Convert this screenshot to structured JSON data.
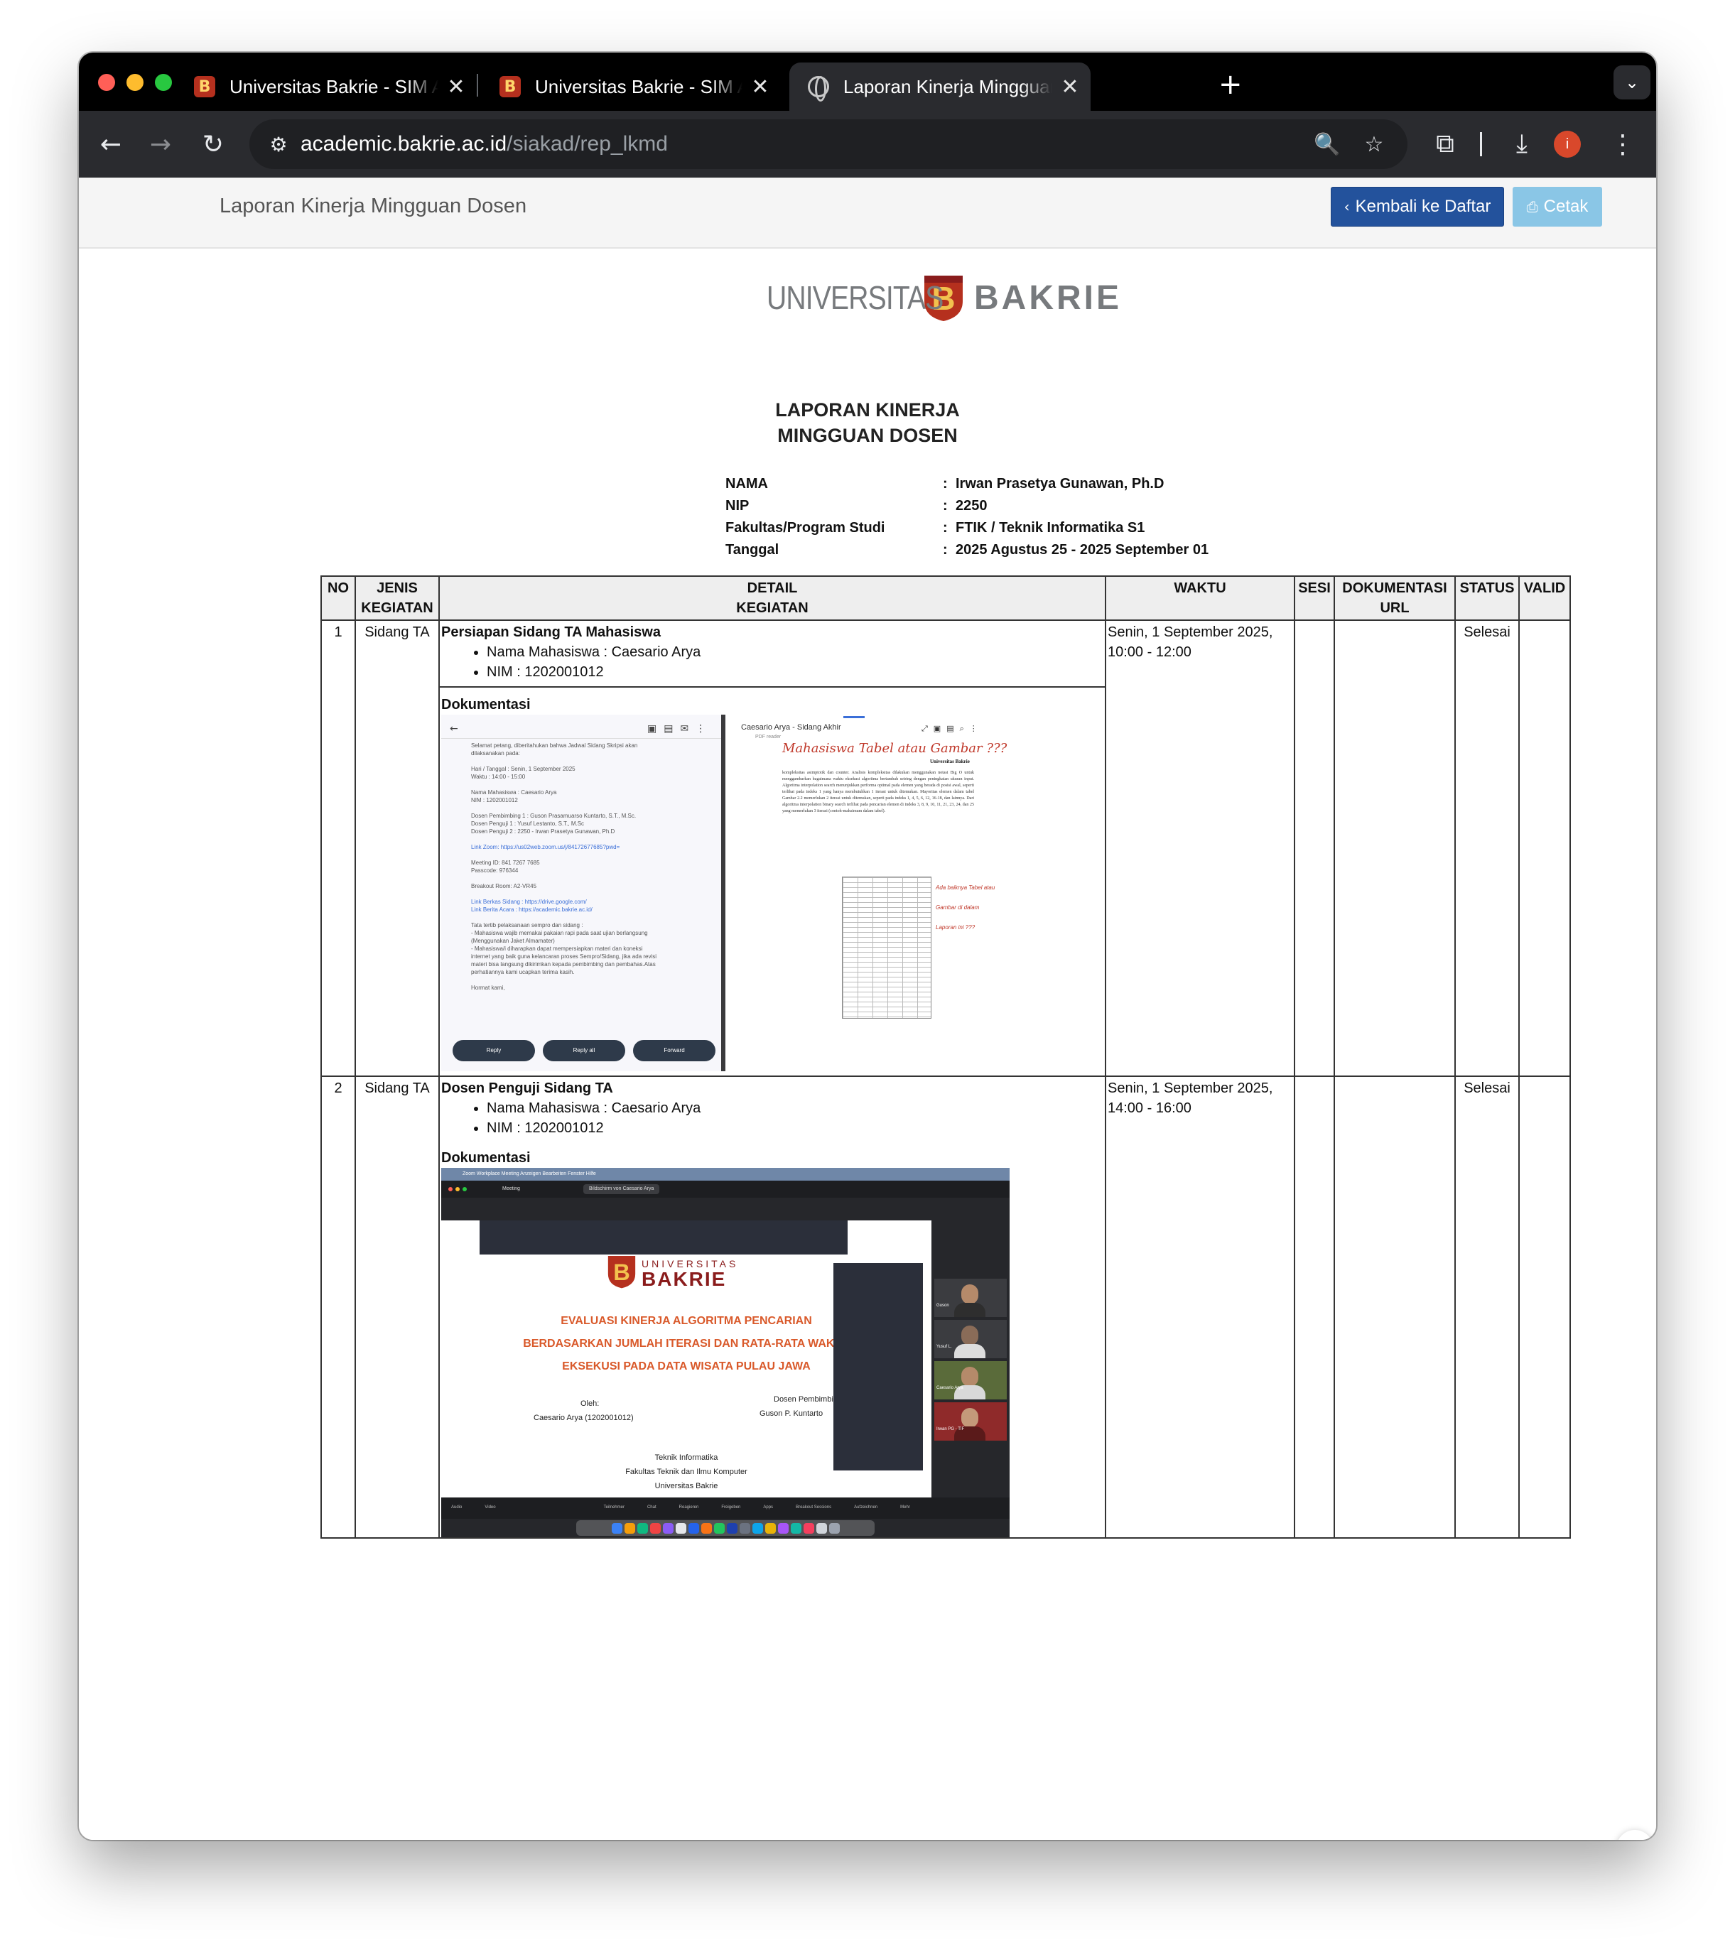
{
  "browser": {
    "tabs": [
      {
        "title": "Universitas Bakrie - SIM Akademik",
        "favicon": "ub-logo-icon",
        "active": false
      },
      {
        "title": "Universitas Bakrie - SIM Akademik",
        "favicon": "ub-logo-icon",
        "active": false
      },
      {
        "title": "Laporan Kinerja Mingguan Dosen",
        "favicon": "globe-icon",
        "active": true
      }
    ],
    "close_glyph": "✕",
    "newtab_glyph": "+",
    "tabmenu_glyph": "⌄",
    "url_host": "academic.bakrie.ac.id",
    "url_path": "/siakad/rep_lkmd",
    "profile_initial": "i",
    "icons": {
      "back": "←",
      "forward": "→",
      "reload": "↻",
      "site_info": "⚙",
      "zoom": "🔍",
      "bookmark": "☆",
      "extensions": "⧉",
      "download": "⤓",
      "menu": "⋮"
    }
  },
  "header": {
    "title": "Laporan Kinerja Mingguan Dosen",
    "back_label": "Kembali ke Daftar",
    "back_icon": "‹",
    "print_label": "Cetak",
    "print_icon": "⎙",
    "back_color": "#23529c",
    "print_color": "#8ac6e6"
  },
  "logo": {
    "left": "UNIVERSITAS",
    "right": "BAKRIE",
    "emblem_letter": "B"
  },
  "report": {
    "title_line1": "LAPORAN KINERJA",
    "title_line2": "MINGGUAN DOSEN",
    "info": [
      {
        "label": "NAMA",
        "value": "Irwan Prasetya Gunawan, Ph.D"
      },
      {
        "label": "NIP",
        "value": "2250"
      },
      {
        "label": "Fakultas/Program Studi",
        "value": "FTIK / Teknik Informatika S1"
      },
      {
        "label": "Tanggal",
        "value": "2025 Agustus 25 - 2025 September 01"
      }
    ],
    "colon": ":"
  },
  "table": {
    "headers": {
      "no": "NO",
      "jenis_1": "JENIS",
      "jenis_2": "KEGIATAN",
      "detail_1": "DETAIL",
      "detail_2": "KEGIATAN",
      "waktu": "WAKTU",
      "sesi": "SESI",
      "dok_1": "DOKUMENTASI",
      "dok_2": "URL",
      "status": "STATUS",
      "valid": "VALID"
    },
    "dok_label": "Dokumentasi",
    "rows": [
      {
        "no": "1",
        "jenis": "Sidang TA",
        "title": "Persiapan Sidang TA Mahasiswa",
        "items": [
          "Nama Mahasiswa : Caesario Arya",
          "NIM : 1202001012"
        ],
        "waktu_1": "Senin, 1 September 2025,",
        "waktu_2": "10:00 - 12:00",
        "sesi": "",
        "dok_url": "",
        "status": "Selesai",
        "valid": ""
      },
      {
        "no": "2",
        "jenis": "Sidang TA",
        "title": "Dosen Penguji Sidang TA",
        "items": [
          "Nama Mahasiswa : Caesario Arya",
          "NIM : 1202001012"
        ],
        "waktu_1": "Senin, 1 September 2025,",
        "waktu_2": "14:00 - 16:00",
        "sesi": "",
        "dok_url": "",
        "status": "Selesai",
        "valid": ""
      }
    ]
  },
  "doc1": {
    "phone_lines": [
      "Selamat petang, diberitahukan bahwa Jadwal Sidang Skripsi akan",
      "dilaksanakan pada:",
      "Hari / Tanggal : Senin, 1 September 2025",
      "Waktu : 14:00 - 15:00",
      "Nama Mahasiswa : Caesario Arya",
      "NIM : 1202001012",
      "Dosen Pembimbing 1 : Guson Prasamuarso Kuntarto, S.T., M.Sc.",
      "Dosen Penguji 1 : Yusuf Lestanto, S.T., M.Sc",
      "Dosen Penguji 2 : 2250 - Irwan Prasetya Gunawan, Ph.D",
      "Link Zoom: https://us02web.zoom.us/j/84172677685?pwd=",
      "Meeting ID: 841 7267 7685",
      "Passcode: 976344",
      "Breakout Room: A2-VR45",
      "Link Berkas Sidang : https://drive.google.com/",
      "Link Berita Acara : https://academic.bakrie.ac.id/",
      "Tata tertib pelaksanaan sempro dan sidang :",
      "- Mahasiswa wajib memakai pakaian rapi pada saat ujian berlangsung",
      "(Menggunakan Jaket Almamater)",
      "- Mahasiswa/i diharapkan dapat mempersiapkan materi dan koneksi",
      "internet yang baik guna kelancaran proses Sempro/Sidang, jika ada revisi",
      "materi bisa langsung dikirimkan kepada pembimbing dan pembahas.Atas",
      "perhatiannya kami ucapkan terima kasih.",
      "Hormat kami,"
    ],
    "phone_buttons": [
      "Reply",
      "Reply all",
      "Forward"
    ],
    "pdf_title": "Caesario Arya - Sidang Akhir",
    "pdf_sub": "PDF reader",
    "pdf_hand": "Mahasiswa Tabel atau Gambar ???",
    "pdf_header": "Universitas Bakrie",
    "pdf_text": "kompleksitas asimptotik dan counter. Analisis kompleksitas dilakukan menggunakan notasi Big O untuk menggambarkan bagaimana waktu eksekusi algoritma bertambah seiring dengan peningkatan ukuran input. Algoritma interpolation search menunjukkan performa optimal pada elemen yang berada di posisi awal, seperti terlihat pada indeks 1 yang hanya membutuhkan 1 iterasi untuk ditemukan. Mayoritas elemen dalam tabel Gambar 2.2 memerlukan 2 iterasi untuk ditemukan, seperti pada indeks 1, 4, 5, 6, 12, 16-18, dan lainnya. Dari algoritma interpolation binary search terlihat pada pencarian elemen di indeks 3, 8, 9, 10, 11, 21, 23, 24, dan 25 yang memerlukan 3 iterasi (contoh-maksimum dalam tabel).",
    "pdf_note": "Ada baiknya Tabel atau Gambar di dalam Laporan ini ???"
  },
  "doc2": {
    "menubar": "Zoom Workplace   Meeting   Anzeigen   Bearbeiten   Fenster   Hilfe",
    "meeting_label": "Meeting",
    "share_label": "Bildschirm von Caesario Arya",
    "slide_logo_small": "UNIVERSITAS",
    "slide_logo_big": "BAKRIE",
    "slide_title_1": "EVALUASI KINERJA ALGORITMA PENCARIAN",
    "slide_title_2": "BERDASARKAN JUMLAH ITERASI DAN RATA-RATA WAKTU",
    "slide_title_3": "EKSEKUSI PADA DATA WISATA PULAU JAWA",
    "oleh": "Oleh:",
    "author": "Caesario Arya (1202001012)",
    "pembimbing_1": "Dosen Pembimbing:",
    "pembimbing_2": "Guson P. Kuntarto",
    "prodi": "Teknik Informatika",
    "fakultas": "Fakultas Teknik dan Ilmu Komputer",
    "univ": "Universitas Bakrie",
    "participants": [
      "Guson",
      "Yusuf L.",
      "Caesario Arya",
      "Irwan PG - TIF"
    ],
    "controls": [
      "Audio",
      "Video",
      "Teilnehmer",
      "Chat",
      "Reagieren",
      "Freigeben",
      "Apps",
      "Breakout Sessions",
      "Aufzeichnen",
      "Mehr"
    ]
  },
  "fab_icon": "ai-assistant-icon",
  "fab_glyph": "✺"
}
